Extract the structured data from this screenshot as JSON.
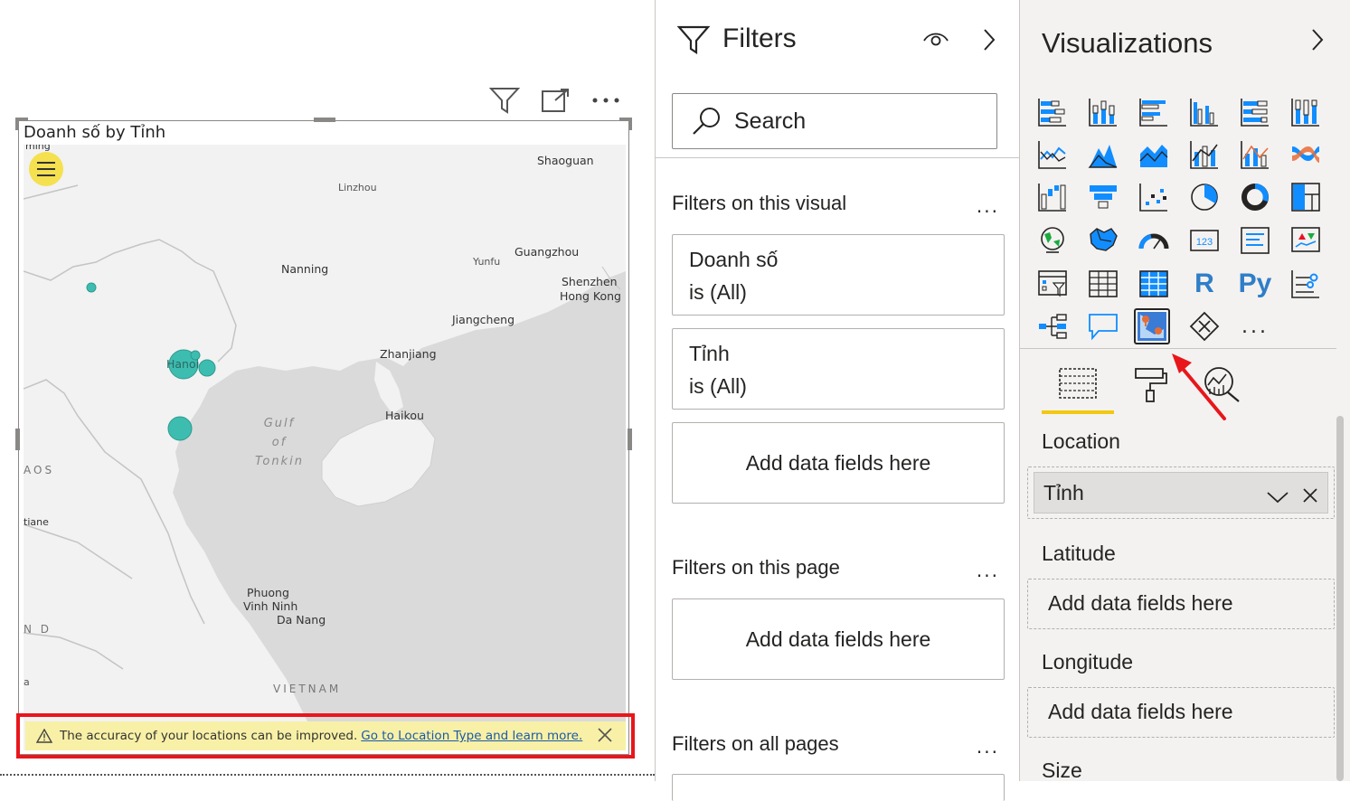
{
  "visual": {
    "title": "Doanh số by Tỉnh",
    "toolbar": [
      "filter-icon",
      "focus-mode-icon",
      "more-options-icon"
    ],
    "map_labels": {
      "shaoguan": "Shaoguan",
      "linzhou": "Linzhou",
      "guangzhou": "Guangzhou",
      "yunfu": "Yunfu",
      "nanning": "Nanning",
      "shenzhen": "Shenzhen",
      "hongkong": "Hong Kong",
      "jiangcheng": "Jiangcheng",
      "zhanjiang": "Zhanjiang",
      "hanoi": "Hanoi",
      "haikou": "Haikou",
      "gulf": "Gulf\nof\nTonkin",
      "laos": "AOS",
      "tiane": "tiane",
      "nd": "N D",
      "phuong": "Phuong",
      "vinhninh": "Vinh Ninh",
      "danang": "Da Nang",
      "vietnam": "VIETNAM",
      "ming": "ming",
      "a": "a"
    },
    "warning": {
      "text": "The accuracy of your locations can be improved.",
      "link": "Go to Location Type and learn more."
    }
  },
  "filters": {
    "title": "Filters",
    "search_placeholder": "Search",
    "on_visual": {
      "heading": "Filters on this visual",
      "cards": [
        {
          "field": "Doanh số",
          "value": "is (All)"
        },
        {
          "field": "Tỉnh",
          "value": "is (All)"
        }
      ],
      "add_label": "Add data fields here"
    },
    "on_page": {
      "heading": "Filters on this page",
      "add_label": "Add data fields here"
    },
    "on_all": {
      "heading": "Filters on all pages"
    },
    "more": "..."
  },
  "visualizations": {
    "title": "Visualizations",
    "more": "...",
    "wells": {
      "location": {
        "label": "Location",
        "value": "Tỉnh"
      },
      "latitude": {
        "label": "Latitude",
        "placeholder": "Add data fields here"
      },
      "longitude": {
        "label": "Longitude",
        "placeholder": "Add data fields here"
      },
      "size": {
        "label": "Size"
      }
    },
    "tabs": [
      "fields-icon",
      "format-icon",
      "analytics-icon"
    ],
    "accent_color": "#f2c811"
  },
  "colors": {
    "bubble": "#3dbdb0",
    "warning_bg": "#f8f0a6",
    "highlight_border": "#e8161b",
    "link": "#1a5aa8"
  }
}
